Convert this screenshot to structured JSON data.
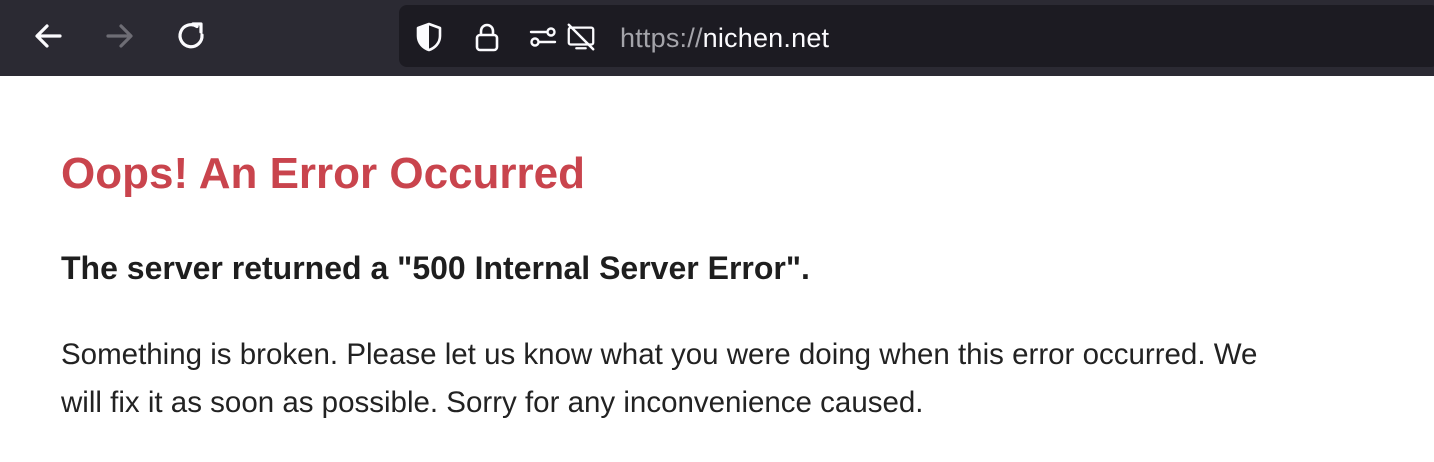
{
  "browser": {
    "nav": {
      "back_icon": "arrow-left-icon",
      "forward_icon": "arrow-right-icon",
      "reload_icon": "reload-icon"
    },
    "urlbar": {
      "scheme": "https://",
      "host": "nichen.net",
      "icons": [
        "shield-icon",
        "lock-icon",
        "permissions-icon",
        "camera-blocked-icon"
      ]
    },
    "colors": {
      "toolbar": "#2b2a33",
      "urlbar": "#1c1b22",
      "url_scheme": "#a4a4aa",
      "url_host": "#fbfbfe"
    }
  },
  "page": {
    "title": "Oops! An Error Occurred",
    "subtitle": "The server returned a \"500 Internal Server Error\".",
    "body": "Something is broken. Please let us know what you were doing when this error occurred. We will fix it as soon as possible. Sorry for any inconvenience caused.",
    "colors": {
      "title": "#c9444d",
      "text": "#1e1e1e"
    }
  }
}
